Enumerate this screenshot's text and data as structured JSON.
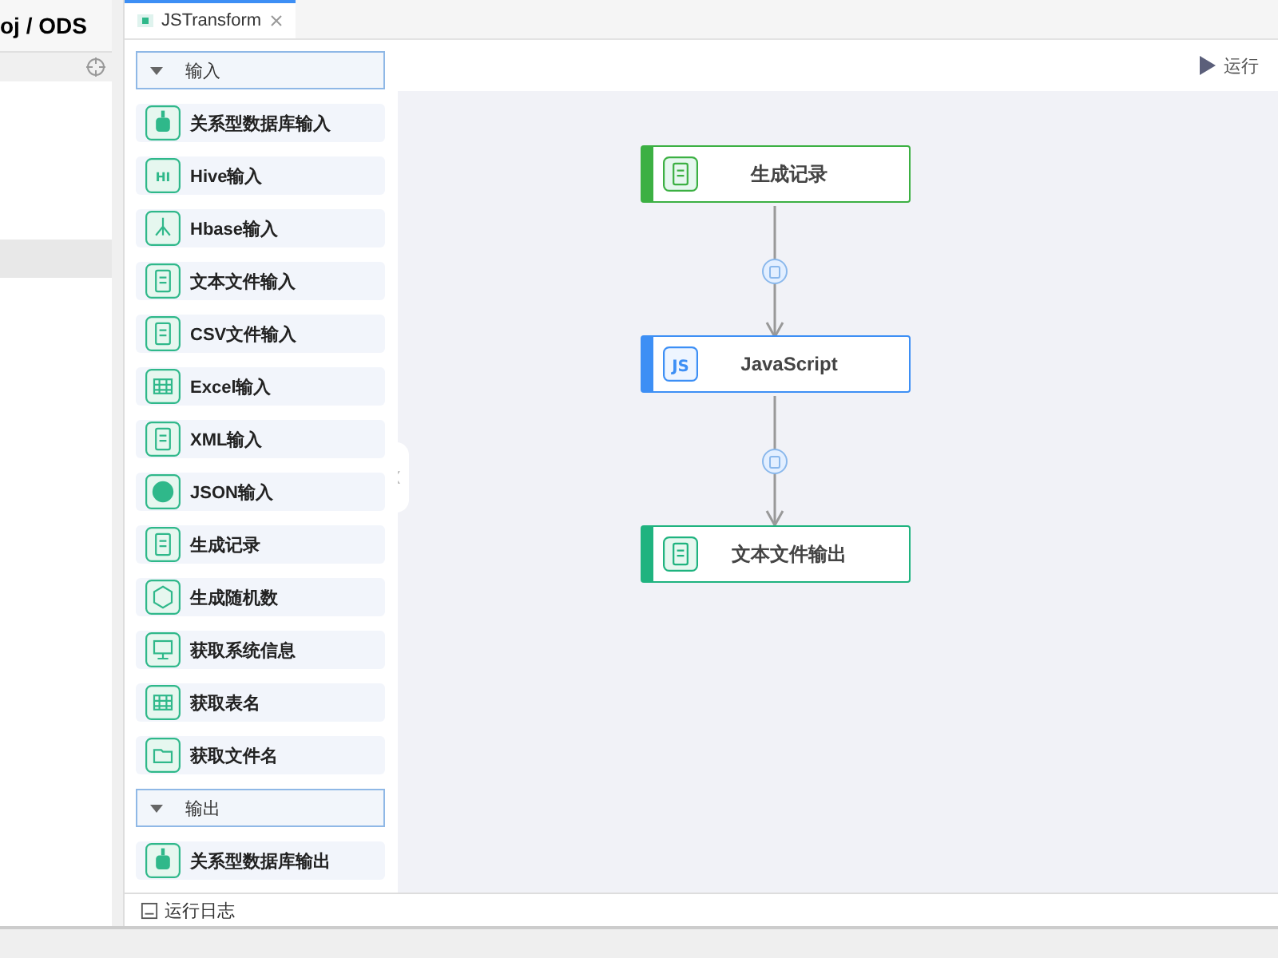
{
  "sidebar": {
    "title": "oj / ODS"
  },
  "tabs": [
    {
      "label": "JSTransform",
      "selected": true
    }
  ],
  "toolbar": {
    "run_label": "运行"
  },
  "palette": [
    {
      "label": "输入",
      "expanded": true,
      "items": [
        {
          "label": "关系型数据库输入",
          "kind": "database"
        },
        {
          "label": "Hive输入",
          "kind": "hive",
          "icon_text": "HI"
        },
        {
          "label": "Hbase输入",
          "kind": "hbase"
        },
        {
          "label": "文本文件输入",
          "kind": "textfile"
        },
        {
          "label": "CSV文件输入",
          "kind": "file"
        },
        {
          "label": "Excel输入",
          "kind": "table"
        },
        {
          "label": "XML输入",
          "kind": "file"
        },
        {
          "label": "JSON输入",
          "kind": "json"
        },
        {
          "label": "生成记录",
          "kind": "records"
        },
        {
          "label": "生成随机数",
          "kind": "random"
        },
        {
          "label": "获取系统信息",
          "kind": "monitor"
        },
        {
          "label": "获取表名",
          "kind": "table"
        },
        {
          "label": "获取文件名",
          "kind": "folder"
        }
      ]
    },
    {
      "label": "输出",
      "expanded": true,
      "items": [
        {
          "label": "关系型数据库输出",
          "kind": "database"
        }
      ]
    }
  ],
  "flow": {
    "nodes": [
      {
        "label": "生成记录",
        "kind": "records",
        "color": "#3cb043"
      },
      {
        "label": "JavaScript",
        "kind": "js",
        "color": "#3d8ff5",
        "icon_text": "JS"
      },
      {
        "label": "文本文件输出",
        "kind": "textfile",
        "color": "#1fb37f"
      }
    ]
  },
  "status_bar": {
    "log_label": "运行日志"
  }
}
